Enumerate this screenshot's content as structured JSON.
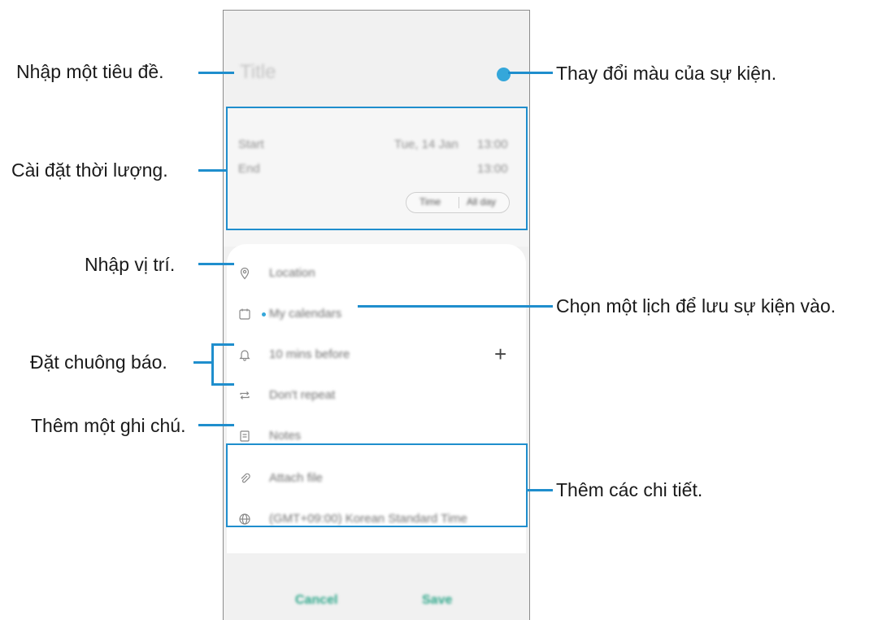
{
  "screen": {
    "title_placeholder": "Title",
    "start_label": "Start",
    "start_date": "Tue, 14 Jan",
    "start_time": "13:00",
    "end_label": "End",
    "end_time": "13:00",
    "time_toggle": "Time",
    "allday_toggle": "All day",
    "rows": {
      "location": "Location",
      "calendar": "My calendars",
      "reminder": "10 mins before",
      "repeat": "Don't repeat",
      "notes": "Notes",
      "attach": "Attach file",
      "timezone": "(GMT+09:00) Korean Standard Time"
    },
    "cancel": "Cancel",
    "save": "Save",
    "add_symbol": "+"
  },
  "callouts": {
    "title": "Nhập một tiêu đề.",
    "duration": "Cài đặt thời lượng.",
    "location": "Nhập vị trí.",
    "alarm": "Đặt chuông báo.",
    "note": "Thêm một ghi chú.",
    "color": "Thay đổi màu của sự kiện.",
    "calendar": "Chọn một lịch để lưu sự kiện vào.",
    "details": "Thêm các chi tiết."
  },
  "colors": {
    "accent": "#1f8ecd",
    "event_color": "#35a7da",
    "button_text": "#2ca689"
  }
}
